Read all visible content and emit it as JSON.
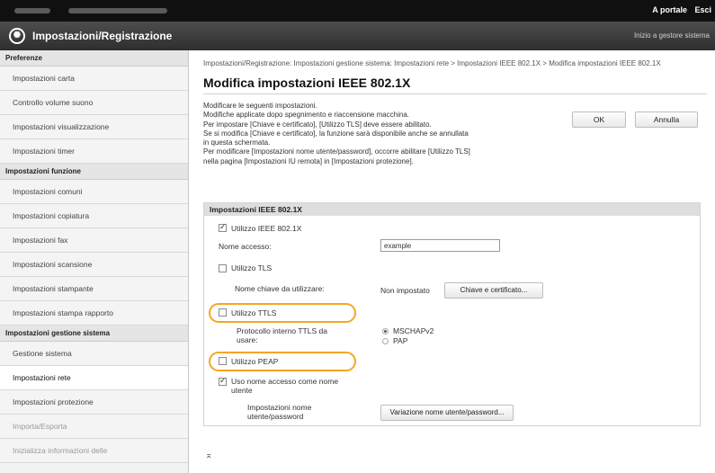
{
  "topbar": {
    "portal": "A portale",
    "logout": "Esci"
  },
  "titlebar": {
    "title": "Impostazioni/Registrazione",
    "home": "Inizio a gestore sistema"
  },
  "sidebar": {
    "groups": [
      {
        "header": "Preferenze",
        "items": [
          "Impostazioni carta",
          "Controllo volume suono",
          "Impostazioni visualizzazione",
          "Impostazioni timer"
        ]
      },
      {
        "header": "Impostazioni funzione",
        "items": [
          "Impostazioni comuni",
          "Impostazioni copiatura",
          "Impostazioni fax",
          "Impostazioni scansione",
          "Impostazioni stampante",
          "Impostazioni stampa rapporto"
        ]
      },
      {
        "header": "Impostazioni gestione sistema",
        "items": [
          "Gestione sistema",
          "Impostazioni rete",
          "Impostazioni protezione",
          "Importa/Esporta",
          "Inizializza informazioni delle"
        ]
      }
    ]
  },
  "main": {
    "breadcrumb": "Impostazioni/Registrazione: Impostazioni gestione sistema: Impostazioni rete > Impostazioni IEEE 802.1X > Modifica impostazioni IEEE 802.1X",
    "title": "Modifica impostazioni IEEE 802.1X",
    "description": [
      "Modificare le seguenti impostazioni.",
      "Modifiche applicate dopo spegnimento e riaccensione macchina.",
      "Per impostare [Chiave e certificato], [Utilizzo TLS] deve essere abilitato.",
      "Se si modifica [Chiave e certificato], la funzione sarà disponibile anche se annullata",
      "in questa schermata.",
      "Per modificare [Impostazioni nome utente/password], occorre abilitare [Utilizzo TLS]",
      "nella pagina [Impostazioni IU remota] in [Impostazioni protezione]."
    ],
    "ok_label": "OK",
    "cancel_label": "Annulla"
  },
  "section": {
    "header": "Impostazioni IEEE 802.1X",
    "use_ieee": "Utilizzo IEEE 802.1X",
    "use_ieee_checked": true,
    "login_name_label": "Nome accesso:",
    "login_name_value": "example",
    "use_tls": "Utilizzo TLS",
    "use_tls_checked": false,
    "key_name_label": "Nome chiave da utilizzare:",
    "key_name_value": "Non impostato",
    "key_button": "Chiave e certificato...",
    "use_ttls": "Utilizzo TTLS",
    "use_ttls_checked": false,
    "ttls_protocol_label_1": "Protocollo interno TTLS da",
    "ttls_protocol_label_2": "usare:",
    "ttls_options": [
      "MSCHAPv2",
      "PAP"
    ],
    "ttls_selected": "MSCHAPv2",
    "use_peap": "Utilizzo PEAP",
    "use_peap_checked": false,
    "use_login_as_user_1": "Uso nome accesso come nome",
    "use_login_as_user_2": "utente",
    "use_login_as_user_checked": true,
    "user_pw_label_1": "Impostazioni nome",
    "user_pw_label_2": "utente/password",
    "user_pw_button": "Variazione nome utente/password..."
  },
  "footer": {
    "top_link": "⌅"
  },
  "colors": {
    "highlight": "#f5a623",
    "titlebar": "#3a3a3a",
    "topbar": "#101010"
  }
}
